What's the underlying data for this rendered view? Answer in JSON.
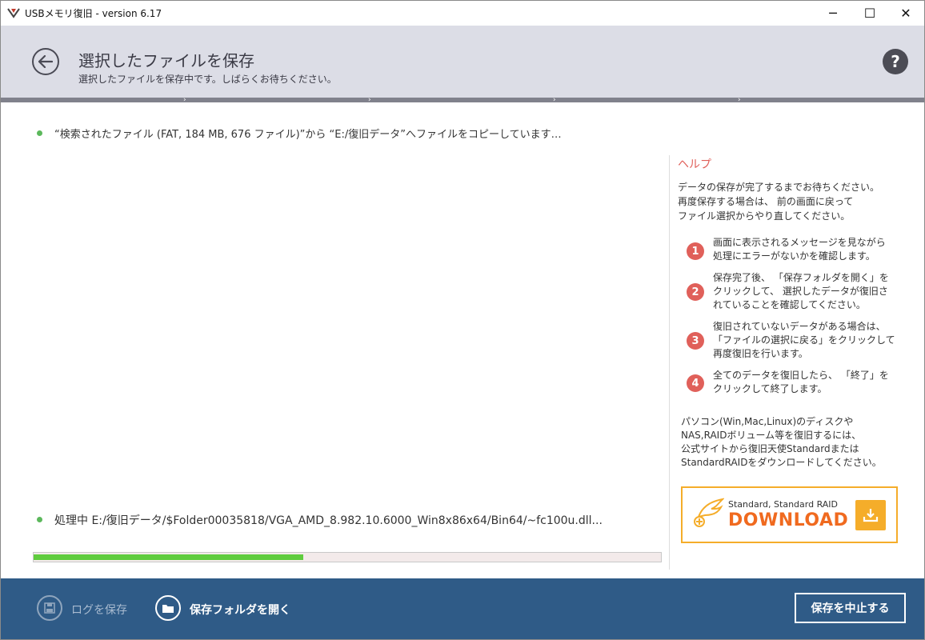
{
  "window": {
    "title": "USBメモリ復旧 - version 6.17",
    "minimize_glyph": "─",
    "maximize_glyph": "☐",
    "close_glyph": "✕"
  },
  "header": {
    "title": "選択したファイルを保存",
    "subtitle": "選択したファイルを保存中です。しばらくお待ちください。",
    "help_glyph": "?"
  },
  "main": {
    "copy_message": "“検索されたファイル (FAT, 184 MB, 676 ファイル)”から “E:/復旧データ”へファイルをコピーしています…",
    "processing_message": "処理中 E:/復旧データ/$Folder00035818/VGA_AMD_8.982.10.6000_Win8x86x64/Bin64/~fc100u.dll...",
    "progress_fraction": 0.43
  },
  "help": {
    "title": "ヘルプ",
    "intro": [
      "データの保存が完了するまでお待ちください。",
      "再度保存する場合は、 前の画面に戻って",
      "ファイル選択からやり直してください。"
    ],
    "steps": [
      {
        "num": "1",
        "lines": [
          "画面に表示されるメッセージを見ながら",
          "処理にエラーがないかを確認します。"
        ]
      },
      {
        "num": "2",
        "lines": [
          "保存完了後、 「保存フォルダを開く」を",
          "クリックして、 選択したデータが復旧さ",
          "れていることを確認してください。"
        ]
      },
      {
        "num": "3",
        "lines": [
          "復旧されていないデータがある場合は、",
          "「ファイルの選択に戻る」をクリックして",
          "再度復旧を行います。"
        ]
      },
      {
        "num": "4",
        "lines": [
          "全てのデータを復旧したら、 「終了」を",
          "クリックして終了します。"
        ]
      }
    ],
    "promo": [
      "パソコン(Win,Mac,Linux)のディスクや",
      "NAS,RAIDボリューム等を復旧するには、",
      "公式サイトから復旧天使Standardまたは",
      "StandardRAIDをダウンロードしてください。"
    ],
    "download_line1": "Standard, Standard RAID",
    "download_line2": "DOWNLOAD"
  },
  "footer": {
    "save_log": "ログを保存",
    "open_folder": "保存フォルダを開く",
    "stop": "保存を中止する"
  },
  "colors": {
    "accent_red": "#e0605a",
    "progress_green": "#5fcc3e",
    "footer_blue": "#2f5b87",
    "download_orange": "#f5ad2a"
  }
}
